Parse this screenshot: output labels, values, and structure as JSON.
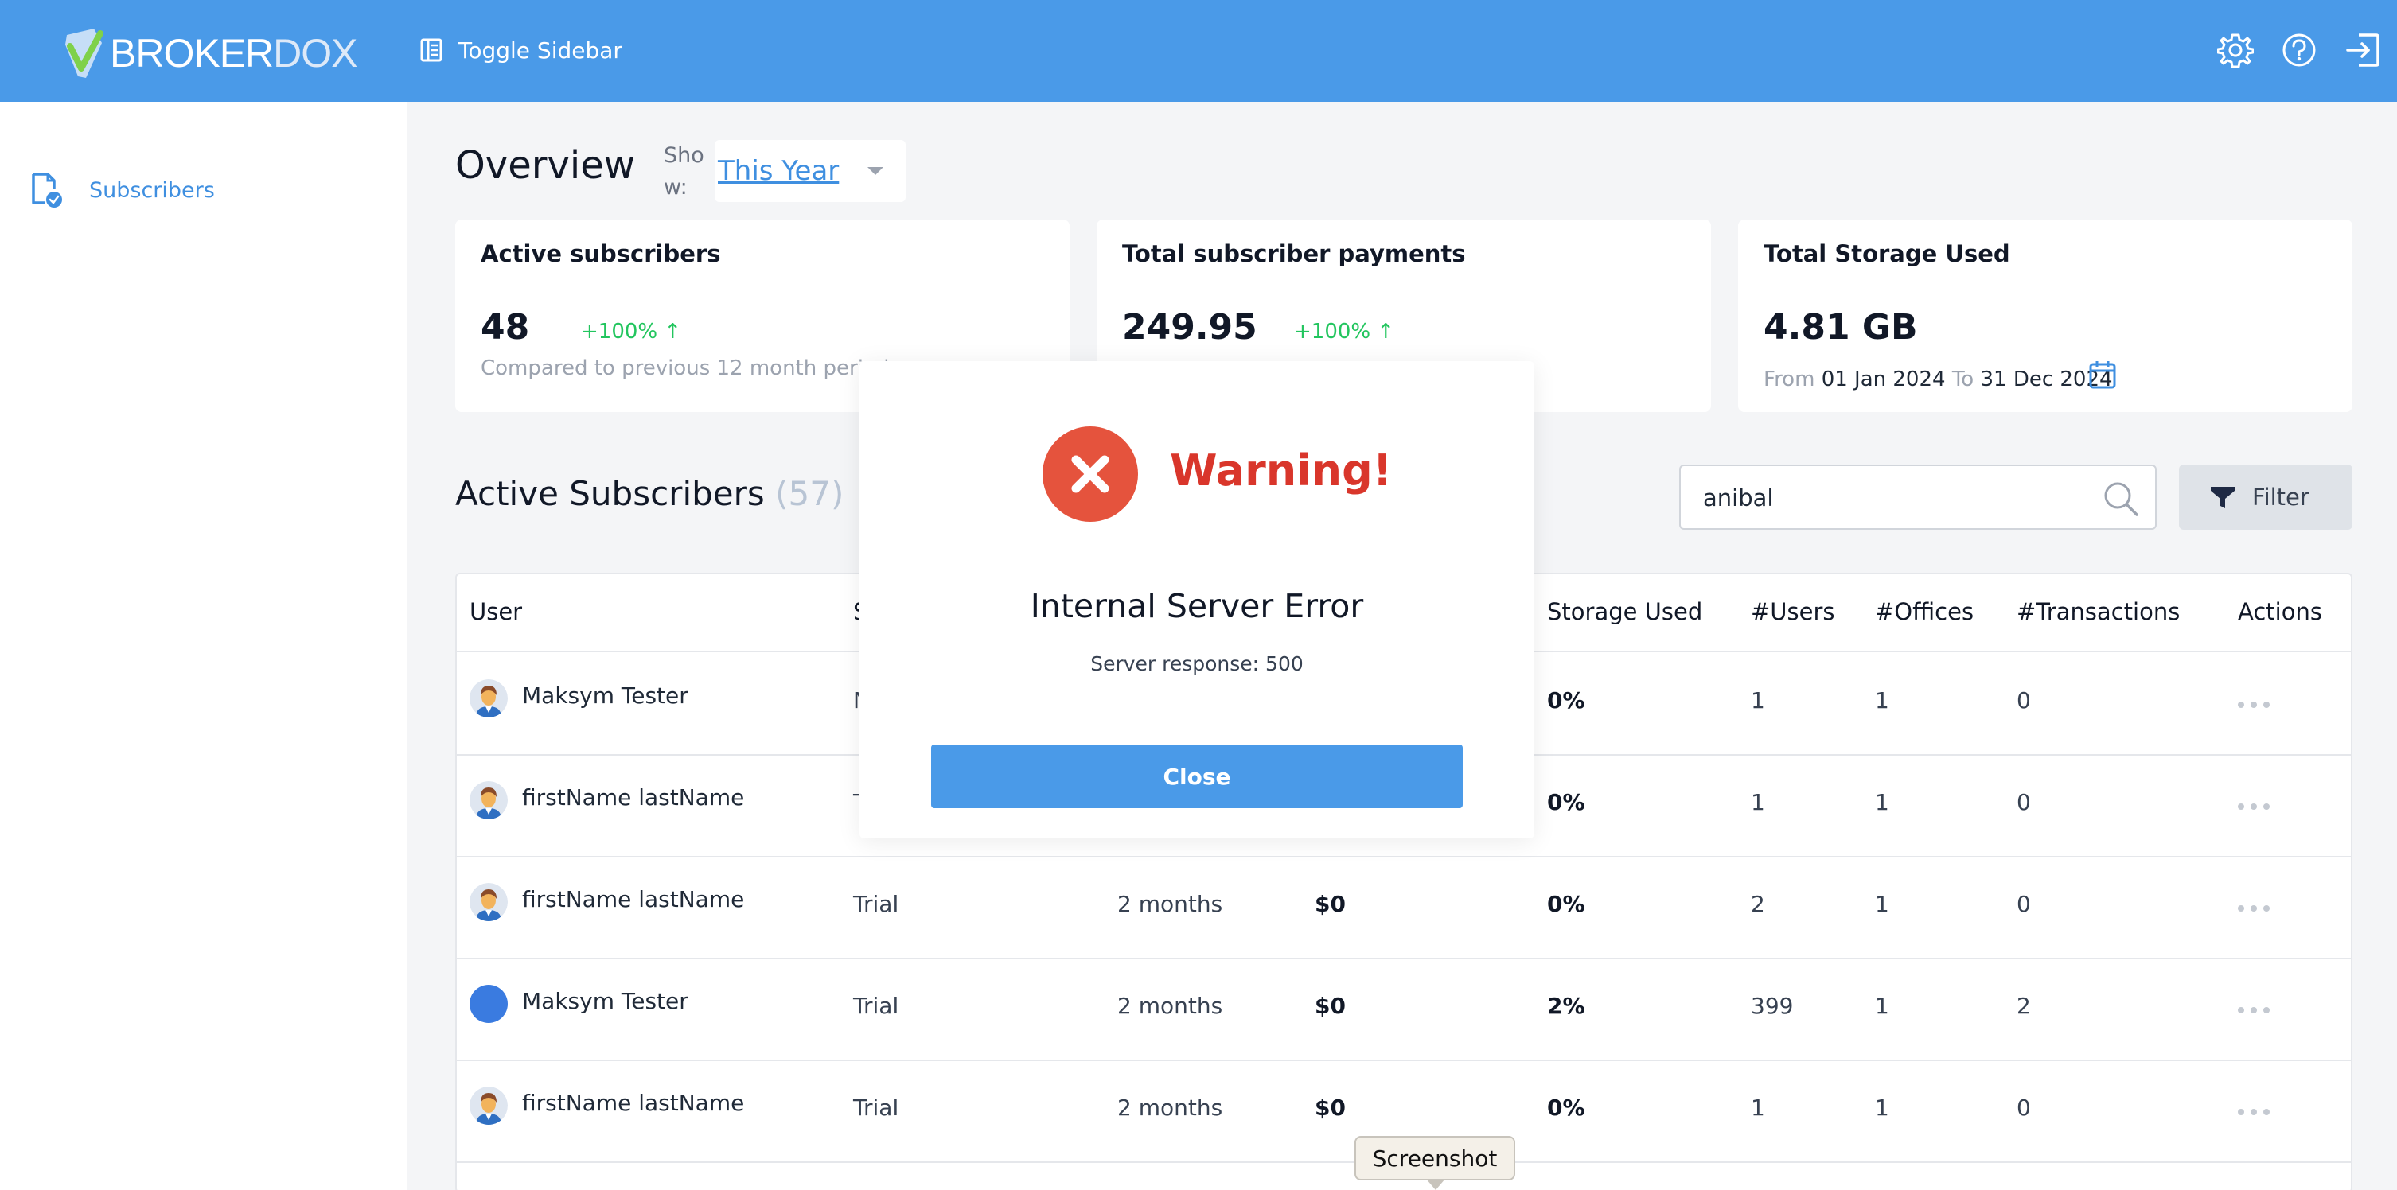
{
  "header": {
    "logo_part1": "BROKER",
    "logo_part2": "DOX",
    "toggle_label": "Toggle Sidebar",
    "icons": [
      "gear-icon",
      "help-icon",
      "logout-icon"
    ],
    "bg_color": "#4a9ae8"
  },
  "sidebar": {
    "items": [
      {
        "label": "Subscribers",
        "icon": "document-check-icon"
      }
    ]
  },
  "overview": {
    "title": "Overview",
    "show_label": "Show:",
    "period": "This Year"
  },
  "cards": [
    {
      "title": "Active subscribers",
      "value": "48",
      "change": "+100% ↑",
      "sub": "Compared to previous 12 month period"
    },
    {
      "title": "Total subscriber payments",
      "value": "249.95",
      "change": "+100% ↑"
    },
    {
      "title": "Total Storage Used",
      "value": "4.81 GB",
      "from_label": "From",
      "from_date": "01 Jan 2024",
      "to_label": "To",
      "to_date": "31 Dec 2024"
    }
  ],
  "subscribers": {
    "title": "Active Subscribers",
    "count": "(57)",
    "search_value": "anibal",
    "filter_label": "Filter",
    "columns": [
      "User",
      "S",
      "Storage Used",
      "#Users",
      "#Offices",
      "#Transactions",
      "Actions"
    ],
    "rows": [
      {
        "user": "Maksym Tester",
        "status": "N",
        "duration": "",
        "paid": "",
        "storage": "0%",
        "users": "1",
        "offices": "1",
        "transactions": "0",
        "avatar": "man"
      },
      {
        "user": "firstName lastName",
        "status": "T",
        "duration": "",
        "paid": "",
        "storage": "0%",
        "users": "1",
        "offices": "1",
        "transactions": "0",
        "avatar": "man"
      },
      {
        "user": "firstName lastName",
        "status": "Trial",
        "duration": "2 months",
        "paid": "$0",
        "storage": "0%",
        "users": "2",
        "offices": "1",
        "transactions": "0",
        "avatar": "man"
      },
      {
        "user": "Maksym Tester",
        "status": "Trial",
        "duration": "2 months",
        "paid": "$0",
        "storage": "2%",
        "users": "399",
        "offices": "1",
        "transactions": "2",
        "avatar": "blue"
      },
      {
        "user": "firstName lastName",
        "status": "Trial",
        "duration": "2 months",
        "paid": "$0",
        "storage": "0%",
        "users": "1",
        "offices": "1",
        "transactions": "0",
        "avatar": "man"
      }
    ]
  },
  "modal": {
    "title": "Warning!",
    "message": "Internal Server Error",
    "detail": "Server response: 500",
    "close_label": "Close",
    "icon": "error-x-icon"
  },
  "tooltip": {
    "text": "Screenshot"
  }
}
